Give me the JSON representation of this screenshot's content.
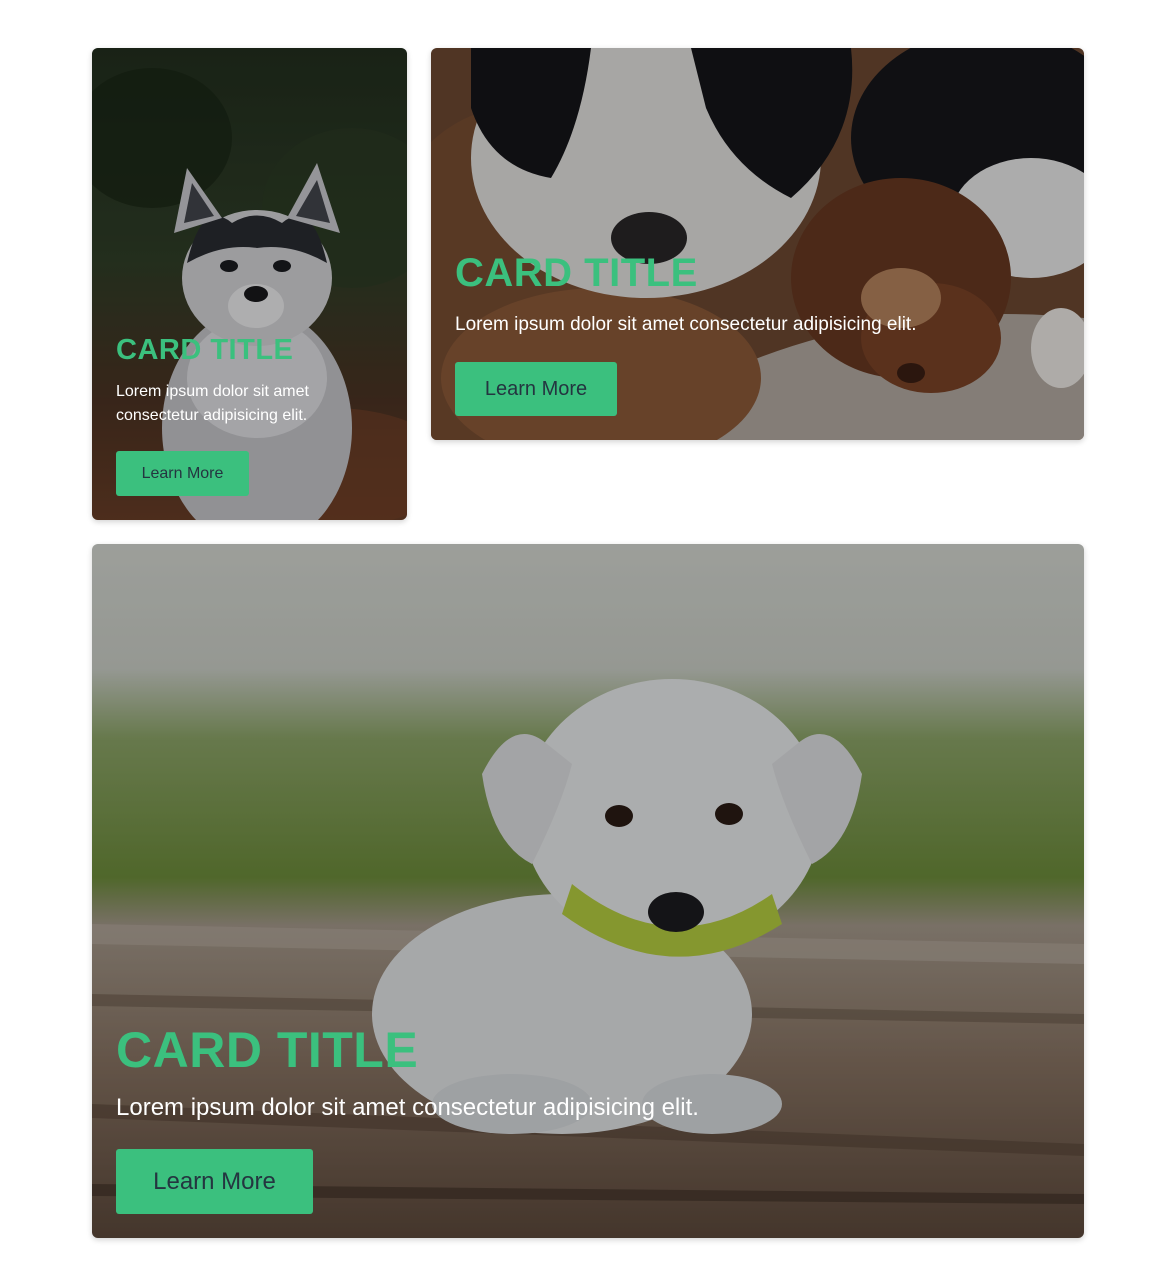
{
  "colors": {
    "accent": "#3bc07e",
    "button_text": "#243540",
    "body_text": "#ffffff",
    "background": "#ffffff"
  },
  "cards": [
    {
      "image": "husky-puppy-photo",
      "title": "CARD TITLE",
      "text": "Lorem ipsum dolor sit amet consectetur adipisicing elit.",
      "button_label": "Learn More"
    },
    {
      "image": "sleeping-puppies-photo",
      "title": "CARD TITLE",
      "text": "Lorem ipsum dolor sit amet consectetur adipisicing elit.",
      "button_label": "Learn More"
    },
    {
      "image": "white-puppy-on-deck-photo",
      "title": "CARD TITLE",
      "text": "Lorem ipsum dolor sit amet consectetur adipisicing elit.",
      "button_label": "Learn More"
    }
  ]
}
